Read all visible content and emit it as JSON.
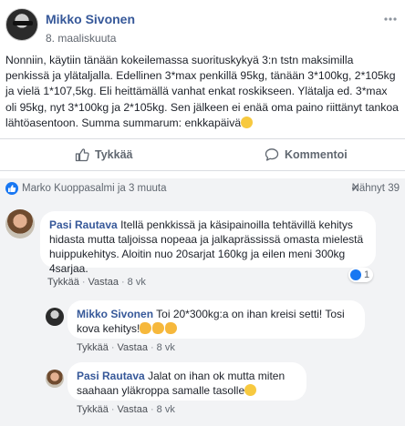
{
  "post": {
    "author": "Mikko Sivonen",
    "date": "8. maaliskuuta",
    "text": "Nonniin, käytiin tänään kokeilemassa suorituskykyä 3:n tstn maksimilla penkissä ja ylätaljalla. Edellinen 3*max penkillä 95kg, tänään 3*100kg, 2*105kg ja vielä 1*107,5kg. Eli heittämällä vanhat enkat roskikseen. Ylätalja ed. 3*max oli 95kg, nyt 3*100kg ja 2*105kg. Sen jälkeen ei enää oma paino riittänyt tankoa lähtöasentoon. Summa summarum: enkkapäivä",
    "more_icon": "more-horizontal-icon"
  },
  "actions": {
    "like_label": "Tykkää",
    "comment_label": "Kommentoi"
  },
  "reactions": {
    "reactors": "Marko Kuoppasalmi ja 3 muuta",
    "seen": "Nähnyt 39"
  },
  "comments": [
    {
      "author": "Pasi Rautava",
      "text": "Itellä penkkissä ja käsipainoilla tehtävillä kehitys hidasta mutta taljoissa nopeaa ja jalkaprässissä omasta mielestä huippukehitys. Aloitin nuo 20sarjat 160kg ja eilen meni 300kg 4sarjaa.",
      "like_label": "Tykkää",
      "reply_label": "Vastaa",
      "time": "8 vk",
      "reaction_count": "1"
    },
    {
      "author": "Mikko Sivonen",
      "text": "Toi 20*300kg:a on ihan kreisi setti! Tosi kova kehitys!",
      "like_label": "Tykkää",
      "reply_label": "Vastaa",
      "time": "8 vk"
    },
    {
      "author": "Pasi Rautava",
      "text": "Jalat on ihan ok mutta miten saahaan yläkroppa samalle tasolle",
      "like_label": "Tykkää",
      "reply_label": "Vastaa",
      "time": "8 vk"
    }
  ],
  "colors": {
    "link_blue": "#365899",
    "like_blue": "#1877f2",
    "muted": "#606770",
    "comment_bg": "#f2f3f5"
  }
}
